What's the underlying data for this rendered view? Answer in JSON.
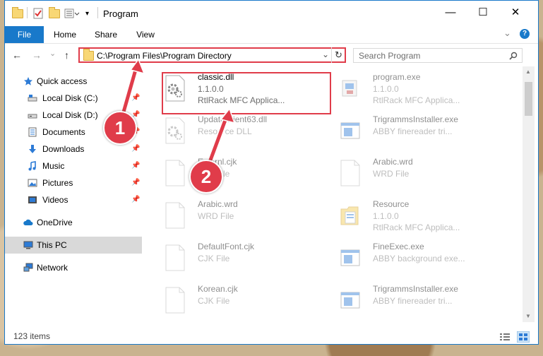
{
  "window": {
    "title": "Program",
    "minimize_glyph": "—",
    "maximize_glyph": "☐",
    "close_glyph": "✕"
  },
  "ribbon": {
    "tabs": [
      "File",
      "Home",
      "Share",
      "View"
    ],
    "expand_glyph": "⌄",
    "help_glyph": "?"
  },
  "nav": {
    "back_glyph": "←",
    "forward_glyph": "→",
    "recent_glyph": "⌄",
    "up_glyph": "↑",
    "address": "C:\\Program Files\\Program Directory",
    "dropdown_glyph": "⌄",
    "refresh_glyph": "↻",
    "search_placeholder": "Search Program",
    "search_icon": "search-icon"
  },
  "sidebar": {
    "items": [
      {
        "label": "Quick access",
        "icon": "star-icon"
      },
      {
        "label": "Local Disk (C:)",
        "icon": "drive-icon"
      },
      {
        "label": "Local Disk (D:)",
        "icon": "drive-icon"
      },
      {
        "label": "Documents",
        "icon": "documents-icon"
      },
      {
        "label": "Downloads",
        "icon": "download-icon"
      },
      {
        "label": "Music",
        "icon": "music-icon"
      },
      {
        "label": "Pictures",
        "icon": "pictures-icon"
      },
      {
        "label": "Videos",
        "icon": "videos-icon"
      },
      {
        "label": "OneDrive",
        "icon": "cloud-icon"
      },
      {
        "label": "This PC",
        "icon": "computer-icon"
      },
      {
        "label": "Network",
        "icon": "network-icon"
      }
    ]
  },
  "files": [
    {
      "name": "classic.dll",
      "line2": "1.1.0.0",
      "line3": "RtlRack MFC Applica...",
      "icon": "dll-gear-icon"
    },
    {
      "name": "program.exe",
      "line2": "1.1.0.0",
      "line3": "RtlRack MFC Applica...",
      "icon": "exe-icon"
    },
    {
      "name": "UpdateClient63.dll",
      "line2": "Resource DLL",
      "line3": "",
      "icon": "dll-gear-icon"
    },
    {
      "name": "TrigrammsInstaller.exe",
      "line2": "ABBY finereader tri...",
      "line3": "",
      "icon": "app-window-icon"
    },
    {
      "name": "Externl.cjk",
      "line2": "CJK File",
      "line3": "",
      "icon": "file-icon"
    },
    {
      "name": "Arabic.wrd",
      "line2": "WRD File",
      "line3": "",
      "icon": "file-icon"
    },
    {
      "name": "Arabic.wrd",
      "line2": "WRD File",
      "line3": "",
      "icon": "file-icon"
    },
    {
      "name": "Resource",
      "line2": "1.1.0.0",
      "line3": "RtlRack MFC Applica...",
      "icon": "resource-folder-icon"
    },
    {
      "name": "DefaultFont.cjk",
      "line2": "CJK File",
      "line3": "",
      "icon": "file-icon"
    },
    {
      "name": "FineExec.exe",
      "line2": "ABBY background exe...",
      "line3": "",
      "icon": "app-window-icon"
    },
    {
      "name": "Korean.cjk",
      "line2": "CJK File",
      "line3": "",
      "icon": "file-icon"
    },
    {
      "name": "TrigrammsInstaller.exe",
      "line2": "ABBY finereader tri...",
      "line3": "",
      "icon": "app-window-icon"
    }
  ],
  "status": {
    "item_count": "123 items"
  },
  "callouts": [
    "1",
    "2"
  ],
  "colors": {
    "accent": "#1979ca",
    "highlight": "#e03c4a"
  }
}
